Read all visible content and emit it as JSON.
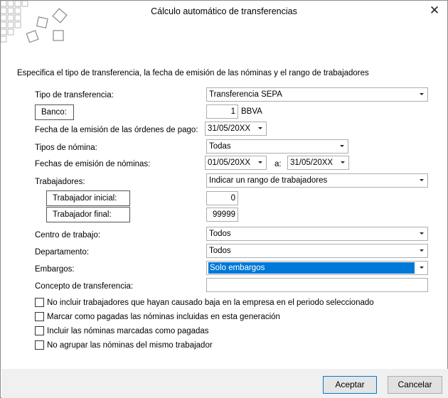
{
  "window": {
    "title": "Cálculo automático de transferencias",
    "close_glyph": "✕"
  },
  "description": "Especifica el tipo de transferencia, la fecha de emisión de las nóminas y el rango de trabajadores",
  "form": {
    "tipo_transferencia_label": "Tipo de transferencia:",
    "tipo_transferencia_value": "Transferencia SEPA",
    "banco_label": "Banco:",
    "banco_code": "1",
    "banco_name": "BBVA",
    "fecha_emision_ordenes_label": "Fecha de la emisión de las órdenes de pago:",
    "fecha_emision_ordenes_value": "31/05/20XX",
    "tipos_nomina_label": "Tipos de nómina:",
    "tipos_nomina_value": "Todas",
    "fechas_emision_nominas_label": "Fechas de emisión de nóminas:",
    "fecha_desde": "01/05/20XX",
    "a_label": "a:",
    "fecha_hasta": "31/05/20XX",
    "trabajadores_label": "Trabajadores:",
    "trabajadores_value": "Indicar un rango de trabajadores",
    "trabajador_inicial_label": "Trabajador inicial:",
    "trabajador_inicial_value": "0",
    "trabajador_final_label": "Trabajador final:",
    "trabajador_final_value": "99999",
    "centro_trabajo_label": "Centro de trabajo:",
    "centro_trabajo_value": "Todos",
    "departamento_label": "Departamento:",
    "departamento_value": "Todos",
    "embargos_label": "Embargos:",
    "embargos_value": "Solo embargos",
    "concepto_label": "Concepto de transferencia:",
    "concepto_value": ""
  },
  "options": [
    {
      "label": "No incluir trabajadores que hayan causado baja en la empresa en el periodo seleccionado",
      "checked": false
    },
    {
      "label": "Marcar como pagadas las nóminas incluidas en esta generación",
      "checked": false
    },
    {
      "label": "Incluir las nóminas marcadas como pagadas",
      "checked": false
    },
    {
      "label": "No agrupar las nóminas del mismo trabajador",
      "checked": false
    }
  ],
  "buttons": {
    "accept": "Aceptar",
    "cancel": "Cancelar"
  },
  "colors": {
    "selection": "#0078d7",
    "footer": "#f0f0f0"
  }
}
